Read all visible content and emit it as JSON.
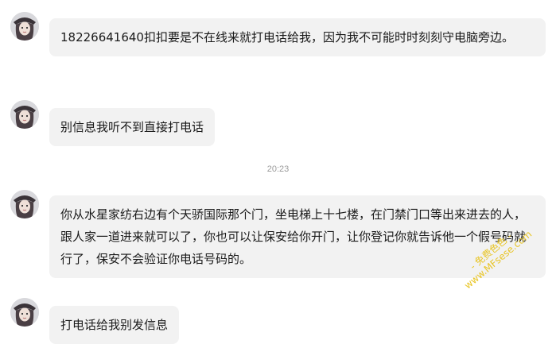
{
  "messages": [
    {
      "text": "18226641640扣扣要是不在线来就打电话给我，因为我不可能时时刻刻守电脑旁边。"
    },
    {
      "text": "别信息我听不到直接打电话"
    },
    {
      "text": "你从水星家纺右边有个天骄国际那个门，坐电梯上十七楼，在门禁门口等出来进去的人，跟人家一道进来就可以了，你也可以让保安给你开门，让你登记你就告诉他一个假号码就行了，保安不会验证你电话号码的。"
    },
    {
      "text": "打电话给我别发信息"
    }
  ],
  "timestamp": "20:23",
  "watermark": {
    "line1": "- 免费色色 -",
    "line2": "www.MFsese.com"
  }
}
